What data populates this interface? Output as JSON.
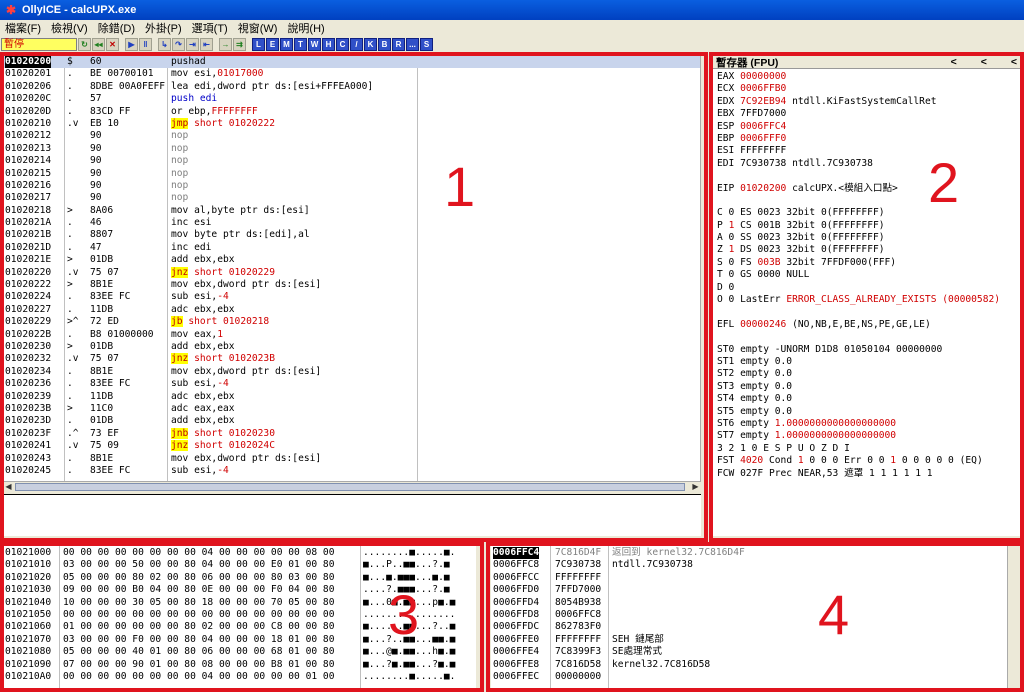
{
  "window": {
    "title": "OllyICE - calcUPX.exe"
  },
  "menu": [
    "檔案(F)",
    "檢視(V)",
    "除錯(D)",
    "外掛(P)",
    "選項(T)",
    "視窗(W)",
    "說明(H)"
  ],
  "toolbar": {
    "status": "暫停",
    "buttons": [
      "↻",
      "◂◂",
      "✕",
      "▶",
      "‖",
      "↳",
      "↷",
      "⇥",
      "⇤",
      "→",
      "⇉"
    ],
    "letters": [
      "L",
      "E",
      "M",
      "T",
      "W",
      "H",
      "C",
      "/",
      "K",
      "B",
      "R",
      "...",
      "S"
    ]
  },
  "disasm": [
    {
      "addr": "01020200",
      "mark": "$",
      "hex": "60",
      "asm": [
        [
          "pushad",
          ""
        ]
      ],
      "sel": true
    },
    {
      "addr": "01020201",
      "mark": ".",
      "hex": "BE 00700101",
      "asm": [
        [
          "mov esi,",
          ""
        ],
        [
          "01017000",
          "red"
        ]
      ]
    },
    {
      "addr": "01020206",
      "mark": ".",
      "hex": "8DBE 00A0FEFF",
      "asm": [
        [
          "lea edi,dword ptr ds:[esi+FFFEA000]",
          ""
        ]
      ]
    },
    {
      "addr": "0102020C",
      "mark": ".",
      "hex": "57",
      "asm": [
        [
          "push edi",
          "blue"
        ]
      ]
    },
    {
      "addr": "0102020D",
      "mark": ".",
      "hex": "83CD FF",
      "asm": [
        [
          "or ebp,",
          ""
        ],
        [
          "FFFFFFFF",
          "red"
        ]
      ]
    },
    {
      "addr": "01020210",
      "mark": ".v",
      "hex": "EB 10",
      "asm": [
        [
          "jmp",
          "jmp"
        ],
        [
          " short 01020222",
          "red"
        ]
      ]
    },
    {
      "addr": "01020212",
      "mark": "",
      "hex": "90",
      "asm": [
        [
          "nop",
          "gray"
        ]
      ]
    },
    {
      "addr": "01020213",
      "mark": "",
      "hex": "90",
      "asm": [
        [
          "nop",
          "gray"
        ]
      ]
    },
    {
      "addr": "01020214",
      "mark": "",
      "hex": "90",
      "asm": [
        [
          "nop",
          "gray"
        ]
      ]
    },
    {
      "addr": "01020215",
      "mark": "",
      "hex": "90",
      "asm": [
        [
          "nop",
          "gray"
        ]
      ]
    },
    {
      "addr": "01020216",
      "mark": "",
      "hex": "90",
      "asm": [
        [
          "nop",
          "gray"
        ]
      ]
    },
    {
      "addr": "01020217",
      "mark": "",
      "hex": "90",
      "asm": [
        [
          "nop",
          "gray"
        ]
      ]
    },
    {
      "addr": "01020218",
      "mark": ">",
      "hex": "8A06",
      "asm": [
        [
          "mov al,byte ptr ds:[esi]",
          ""
        ]
      ]
    },
    {
      "addr": "0102021A",
      "mark": ".",
      "hex": "46",
      "asm": [
        [
          "inc esi",
          ""
        ]
      ]
    },
    {
      "addr": "0102021B",
      "mark": ".",
      "hex": "8807",
      "asm": [
        [
          "mov byte ptr ds:[edi],al",
          ""
        ]
      ]
    },
    {
      "addr": "0102021D",
      "mark": ".",
      "hex": "47",
      "asm": [
        [
          "inc edi",
          ""
        ]
      ]
    },
    {
      "addr": "0102021E",
      "mark": ">",
      "hex": "01DB",
      "asm": [
        [
          "add ebx,ebx",
          ""
        ]
      ]
    },
    {
      "addr": "01020220",
      "mark": ".v",
      "hex": "75 07",
      "asm": [
        [
          "jnz",
          "jmp"
        ],
        [
          " short 01020229",
          "red"
        ]
      ]
    },
    {
      "addr": "01020222",
      "mark": ">",
      "hex": "8B1E",
      "asm": [
        [
          "mov ebx,dword ptr ds:[esi]",
          ""
        ]
      ]
    },
    {
      "addr": "01020224",
      "mark": ".",
      "hex": "83EE FC",
      "asm": [
        [
          "sub esi,",
          ""
        ],
        [
          "-4",
          "red"
        ]
      ]
    },
    {
      "addr": "01020227",
      "mark": ".",
      "hex": "11DB",
      "asm": [
        [
          "adc ebx,ebx",
          ""
        ]
      ]
    },
    {
      "addr": "01020229",
      "mark": ">^",
      "hex": "72 ED",
      "asm": [
        [
          "jb",
          "jmp"
        ],
        [
          " short 01020218",
          "red"
        ]
      ]
    },
    {
      "addr": "0102022B",
      "mark": ".",
      "hex": "B8 01000000",
      "asm": [
        [
          "mov eax,",
          ""
        ],
        [
          "1",
          "red"
        ]
      ]
    },
    {
      "addr": "01020230",
      "mark": ">",
      "hex": "01DB",
      "asm": [
        [
          "add ebx,ebx",
          ""
        ]
      ]
    },
    {
      "addr": "01020232",
      "mark": ".v",
      "hex": "75 07",
      "asm": [
        [
          "jnz",
          "jmp"
        ],
        [
          " short 0102023B",
          "red"
        ]
      ]
    },
    {
      "addr": "01020234",
      "mark": ".",
      "hex": "8B1E",
      "asm": [
        [
          "mov ebx,dword ptr ds:[esi]",
          ""
        ]
      ]
    },
    {
      "addr": "01020236",
      "mark": ".",
      "hex": "83EE FC",
      "asm": [
        [
          "sub esi,",
          ""
        ],
        [
          "-4",
          "red"
        ]
      ]
    },
    {
      "addr": "01020239",
      "mark": ".",
      "hex": "11DB",
      "asm": [
        [
          "adc ebx,ebx",
          ""
        ]
      ]
    },
    {
      "addr": "0102023B",
      "mark": ">",
      "hex": "11C0",
      "asm": [
        [
          "adc eax,eax",
          ""
        ]
      ]
    },
    {
      "addr": "0102023D",
      "mark": ".",
      "hex": "01DB",
      "asm": [
        [
          "add ebx,ebx",
          ""
        ]
      ]
    },
    {
      "addr": "0102023F",
      "mark": ".^",
      "hex": "73 EF",
      "asm": [
        [
          "jnb",
          "jmp"
        ],
        [
          " short 01020230",
          "red"
        ]
      ]
    },
    {
      "addr": "01020241",
      "mark": ".v",
      "hex": "75 09",
      "asm": [
        [
          "jnz",
          "jmp"
        ],
        [
          " short 0102024C",
          "red"
        ]
      ]
    },
    {
      "addr": "01020243",
      "mark": ".",
      "hex": "8B1E",
      "asm": [
        [
          "mov ebx,dword ptr ds:[esi]",
          ""
        ]
      ]
    },
    {
      "addr": "01020245",
      "mark": ".",
      "hex": "83EE FC",
      "asm": [
        [
          "sub esi,",
          ""
        ],
        [
          "-4",
          "red"
        ]
      ]
    }
  ],
  "registers": {
    "header": "暫存器 (FPU)",
    "lines": [
      [
        [
          "EAX ",
          ""
        ],
        [
          "00000000",
          "red"
        ]
      ],
      [
        [
          "ECX ",
          ""
        ],
        [
          "0006FFB0",
          "red"
        ]
      ],
      [
        [
          "EDX ",
          ""
        ],
        [
          "7C92EB94",
          "red"
        ],
        [
          " ntdll.KiFastSystemCallRet",
          ""
        ]
      ],
      [
        [
          "EBX 7FFD7000",
          ""
        ]
      ],
      [
        [
          "ESP ",
          ""
        ],
        [
          "0006FFC4",
          "red"
        ]
      ],
      [
        [
          "EBP ",
          ""
        ],
        [
          "0006FFF0",
          "red"
        ]
      ],
      [
        [
          "ESI FFFFFFFF",
          ""
        ]
      ],
      [
        [
          "EDI 7C930738 ntdll.7C930738",
          ""
        ]
      ],
      [
        [
          "",
          ""
        ]
      ],
      [
        [
          "EIP ",
          ""
        ],
        [
          "01020200",
          "red"
        ],
        [
          " calcUPX.<模組入口點>",
          ""
        ]
      ],
      [
        [
          "",
          ""
        ]
      ],
      [
        [
          "C 0  ES 0023 32bit 0(FFFFFFFF)",
          ""
        ]
      ],
      [
        [
          "P ",
          ""
        ],
        [
          "1",
          "red"
        ],
        [
          "  CS 001B 32bit 0(FFFFFFFF)",
          ""
        ]
      ],
      [
        [
          "A 0  SS 0023 32bit 0(FFFFFFFF)",
          ""
        ]
      ],
      [
        [
          "Z ",
          ""
        ],
        [
          "1",
          "red"
        ],
        [
          "  DS 0023 32bit 0(FFFFFFFF)",
          ""
        ]
      ],
      [
        [
          "S 0  FS ",
          ""
        ],
        [
          "003B",
          "red"
        ],
        [
          " 32bit 7FFDF000(FFF)",
          ""
        ]
      ],
      [
        [
          "T 0  GS 0000 NULL",
          ""
        ]
      ],
      [
        [
          "D 0",
          ""
        ]
      ],
      [
        [
          "O 0  LastErr ",
          ""
        ],
        [
          "ERROR_CLASS_ALREADY_EXISTS (00000582)",
          "red"
        ]
      ],
      [
        [
          "",
          ""
        ]
      ],
      [
        [
          "EFL ",
          ""
        ],
        [
          "00000246",
          "red"
        ],
        [
          " (NO,NB,E,BE,NS,PE,GE,LE)",
          ""
        ]
      ],
      [
        [
          "",
          ""
        ]
      ],
      [
        [
          "ST0 empty -UNORM D1D8 01050104 00000000",
          ""
        ]
      ],
      [
        [
          "ST1 empty 0.0",
          ""
        ]
      ],
      [
        [
          "ST2 empty 0.0",
          ""
        ]
      ],
      [
        [
          "ST3 empty 0.0",
          ""
        ]
      ],
      [
        [
          "ST4 empty 0.0",
          ""
        ]
      ],
      [
        [
          "ST5 empty 0.0",
          ""
        ]
      ],
      [
        [
          "ST6 empty ",
          ""
        ],
        [
          "1.0000000000000000000",
          "red"
        ]
      ],
      [
        [
          "ST7 empty ",
          ""
        ],
        [
          "1.0000000000000000000",
          "red"
        ]
      ],
      [
        [
          "               3 2 1 0      E S P U O Z D I",
          ""
        ]
      ],
      [
        [
          "FST ",
          ""
        ],
        [
          "4020",
          "red"
        ],
        [
          "  Cond ",
          ""
        ],
        [
          "1",
          "red"
        ],
        [
          " 0 0 0  Err 0 0 ",
          ""
        ],
        [
          "1",
          "red"
        ],
        [
          " 0 0 0 0 0  (EQ)",
          ""
        ]
      ],
      [
        [
          "FCW 027F  Prec NEAR,53  遮罩    1 1 1 1 1 1",
          ""
        ]
      ]
    ]
  },
  "dump": [
    {
      "addr": "01021000",
      "hex": "00 00 00 00 00 00 00 00 04 00 00 00 00 00 08 00",
      "asc": "........■.....■."
    },
    {
      "addr": "01021010",
      "hex": "03 00 00 00 50 00 00 80 04 00 00 00 E0 01 00 80",
      "asc": "■...P..■■...?.■"
    },
    {
      "addr": "01021020",
      "hex": "05 00 00 00 80 02 00 80 06 00 00 00 80 03 00 80",
      "asc": "■...■.■■■...■.■"
    },
    {
      "addr": "01021030",
      "hex": "09 00 00 00 B0 04 00 80 0E 00 00 00 F0 04 00 80",
      "asc": "....?.■■■...?.■"
    },
    {
      "addr": "01021040",
      "hex": "10 00 00 00 30 05 00 80 18 00 00 00 70 05 00 80",
      "asc": "■...0■.■■...p■.■"
    },
    {
      "addr": "01021050",
      "hex": "00 00 00 00 00 00 00 00 00 00 00 00 00 00 00 00",
      "asc": "................"
    },
    {
      "addr": "01021060",
      "hex": "01 00 00 00 00 00 00 80 02 00 00 00 C8 00 00 80",
      "asc": "■......■■...?..■"
    },
    {
      "addr": "01021070",
      "hex": "03 00 00 00 F0 00 00 80 04 00 00 00 18 01 00 80",
      "asc": "■...?..■■...■■.■"
    },
    {
      "addr": "01021080",
      "hex": "05 00 00 00 40 01 00 80 06 00 00 00 68 01 00 80",
      "asc": "■...@■.■■...h■.■"
    },
    {
      "addr": "01021090",
      "hex": "07 00 00 00 90 01 00 80 08 00 00 00 B8 01 00 80",
      "asc": "■...?■.■■...?■.■"
    },
    {
      "addr": "010210A0",
      "hex": "00 00 00 00 00 00 00 00 04 00 00 00 00 00 01 00",
      "asc": "........■.....■."
    }
  ],
  "stack": [
    {
      "addr": "0006FFC4",
      "val": "7C816D4F",
      "note": "返回到 kernel32.7C816D4F",
      "sel": true
    },
    {
      "addr": "0006FFC8",
      "val": "7C930738",
      "note": "ntdll.7C930738"
    },
    {
      "addr": "0006FFCC",
      "val": "FFFFFFFF",
      "note": ""
    },
    {
      "addr": "0006FFD0",
      "val": "7FFD7000",
      "note": ""
    },
    {
      "addr": "0006FFD4",
      "val": "8054B938",
      "note": ""
    },
    {
      "addr": "0006FFD8",
      "val": "0006FFC8",
      "note": ""
    },
    {
      "addr": "0006FFDC",
      "val": "862783F0",
      "note": ""
    },
    {
      "addr": "0006FFE0",
      "val": "FFFFFFFF",
      "note": "SEH 鏈尾部"
    },
    {
      "addr": "0006FFE4",
      "val": "7C8399F3",
      "note": "SE處理常式"
    },
    {
      "addr": "0006FFE8",
      "val": "7C816D58",
      "note": "kernel32.7C816D58"
    },
    {
      "addr": "0006FFEC",
      "val": "00000000",
      "note": ""
    }
  ],
  "annotations": [
    "1",
    "2",
    "3",
    "4"
  ],
  "colors": {
    "annotation": "#e0141e",
    "selection": "#000000",
    "jump_highlight": "#ffff00",
    "value_red": "#d00000"
  }
}
